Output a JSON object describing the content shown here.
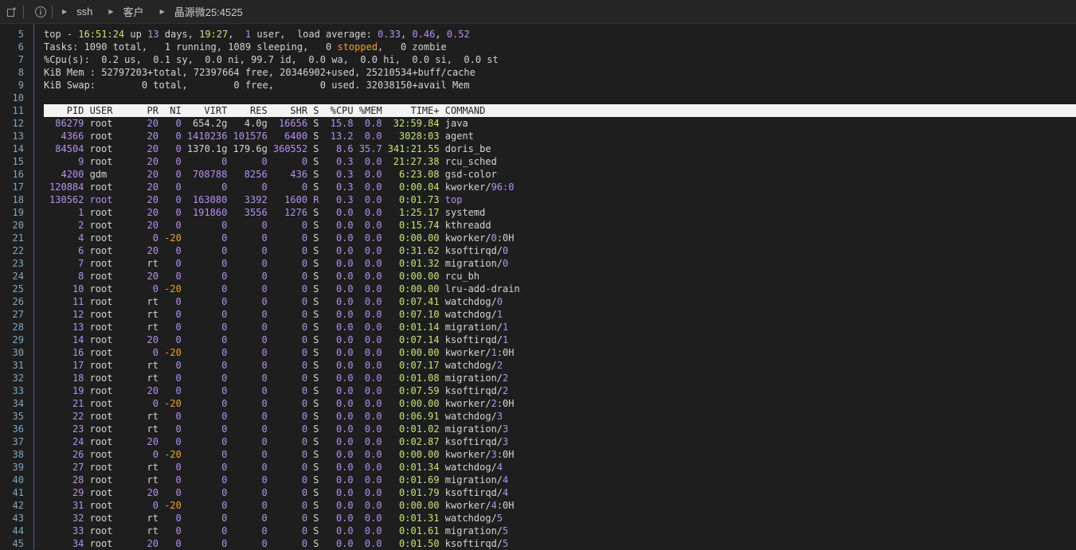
{
  "toolbar": {
    "breadcrumbs": [
      "ssh",
      "客户",
      "晶源微25:4525"
    ],
    "icons": {
      "new": "new-file-icon",
      "info": "info-icon",
      "triangle": "triangle-right-icon"
    }
  },
  "summary": {
    "line1": {
      "p1": "top - ",
      "time": "16:51:24",
      "p2": " up ",
      "days": "13",
      "p3": " days, ",
      "uptime": "19:27",
      "p4": ",  ",
      "users": "1",
      "p5": " user,  load average: ",
      "l1": "0.33",
      "p6": ", ",
      "l2": "0.46",
      "p7": ", ",
      "l3": "0.52"
    },
    "line2": {
      "p1": "Tasks: 1090 total,   1 running, 1089 sleeping,   0 ",
      "stopped": "stopped",
      "p2": ",   0 zombie"
    },
    "line3": "%Cpu(s):  0.2 us,  0.1 sy,  0.0 ni, 99.7 id,  0.0 wa,  0.0 hi,  0.0 si,  0.0 st",
    "line4": "KiB Mem : 52797203+total, 72397664 free, 20346902+used, 25210534+buff/cache",
    "line5": "KiB Swap:        0 total,        0 free,        0 used. 32038150+avail Mem"
  },
  "line_numbers": [
    "5",
    "6",
    "7",
    "8",
    "9",
    "10",
    "11",
    "12",
    "13",
    "14",
    "15",
    "16",
    "17",
    "18",
    "19",
    "20",
    "21",
    "22",
    "23",
    "24",
    "25",
    "26",
    "27",
    "28",
    "29",
    "30",
    "31",
    "32",
    "33",
    "34",
    "35",
    "36",
    "37",
    "38",
    "39",
    "40",
    "41",
    "42",
    "43",
    "44",
    "45"
  ],
  "header": [
    "PID",
    "USER",
    "PR",
    "NI",
    "VIRT",
    "RES",
    "SHR",
    "S",
    "%CPU",
    "%MEM",
    "TIME+",
    "COMMAND"
  ],
  "processes": [
    [
      "86279",
      "root",
      "20",
      "0",
      "654.2g",
      "4.0g",
      "16656",
      "S",
      "15.8",
      "0.8",
      "32:59.84",
      "java"
    ],
    [
      "4366",
      "root",
      "20",
      "0",
      "1410236",
      "101576",
      "6400",
      "S",
      "13.2",
      "0.0",
      "3028:03",
      "agent"
    ],
    [
      "84504",
      "root",
      "20",
      "0",
      "1370.1g",
      "179.6g",
      "360552",
      "S",
      "8.6",
      "35.7",
      "341:21.55",
      "doris_be"
    ],
    [
      "9",
      "root",
      "20",
      "0",
      "0",
      "0",
      "0",
      "S",
      "0.3",
      "0.0",
      "21:27.38",
      "rcu_sched"
    ],
    [
      "4200",
      "gdm",
      "20",
      "0",
      "708788",
      "8256",
      "436",
      "S",
      "0.3",
      "0.0",
      "6:23.08",
      "gsd-color"
    ],
    [
      "120884",
      "root",
      "20",
      "0",
      "0",
      "0",
      "0",
      "S",
      "0.3",
      "0.0",
      "0:00.04",
      "kworker/96:0"
    ],
    [
      "130562",
      "root",
      "20",
      "0",
      "163080",
      "3392",
      "1600",
      "R",
      "0.3",
      "0.0",
      "0:01.73",
      "top"
    ],
    [
      "1",
      "root",
      "20",
      "0",
      "191860",
      "3556",
      "1276",
      "S",
      "0.0",
      "0.0",
      "1:25.17",
      "systemd"
    ],
    [
      "2",
      "root",
      "20",
      "0",
      "0",
      "0",
      "0",
      "S",
      "0.0",
      "0.0",
      "0:15.74",
      "kthreadd"
    ],
    [
      "4",
      "root",
      "0",
      "-20",
      "0",
      "0",
      "0",
      "S",
      "0.0",
      "0.0",
      "0:00.00",
      "kworker/0:0H"
    ],
    [
      "6",
      "root",
      "20",
      "0",
      "0",
      "0",
      "0",
      "S",
      "0.0",
      "0.0",
      "0:31.62",
      "ksoftirqd/0"
    ],
    [
      "7",
      "root",
      "rt",
      "0",
      "0",
      "0",
      "0",
      "S",
      "0.0",
      "0.0",
      "0:01.32",
      "migration/0"
    ],
    [
      "8",
      "root",
      "20",
      "0",
      "0",
      "0",
      "0",
      "S",
      "0.0",
      "0.0",
      "0:00.00",
      "rcu_bh"
    ],
    [
      "10",
      "root",
      "0",
      "-20",
      "0",
      "0",
      "0",
      "S",
      "0.0",
      "0.0",
      "0:00.00",
      "lru-add-drain"
    ],
    [
      "11",
      "root",
      "rt",
      "0",
      "0",
      "0",
      "0",
      "S",
      "0.0",
      "0.0",
      "0:07.41",
      "watchdog/0"
    ],
    [
      "12",
      "root",
      "rt",
      "0",
      "0",
      "0",
      "0",
      "S",
      "0.0",
      "0.0",
      "0:07.10",
      "watchdog/1"
    ],
    [
      "13",
      "root",
      "rt",
      "0",
      "0",
      "0",
      "0",
      "S",
      "0.0",
      "0.0",
      "0:01.14",
      "migration/1"
    ],
    [
      "14",
      "root",
      "20",
      "0",
      "0",
      "0",
      "0",
      "S",
      "0.0",
      "0.0",
      "0:07.14",
      "ksoftirqd/1"
    ],
    [
      "16",
      "root",
      "0",
      "-20",
      "0",
      "0",
      "0",
      "S",
      "0.0",
      "0.0",
      "0:00.00",
      "kworker/1:0H"
    ],
    [
      "17",
      "root",
      "rt",
      "0",
      "0",
      "0",
      "0",
      "S",
      "0.0",
      "0.0",
      "0:07.17",
      "watchdog/2"
    ],
    [
      "18",
      "root",
      "rt",
      "0",
      "0",
      "0",
      "0",
      "S",
      "0.0",
      "0.0",
      "0:01.08",
      "migration/2"
    ],
    [
      "19",
      "root",
      "20",
      "0",
      "0",
      "0",
      "0",
      "S",
      "0.0",
      "0.0",
      "0:07.59",
      "ksoftirqd/2"
    ],
    [
      "21",
      "root",
      "0",
      "-20",
      "0",
      "0",
      "0",
      "S",
      "0.0",
      "0.0",
      "0:00.00",
      "kworker/2:0H"
    ],
    [
      "22",
      "root",
      "rt",
      "0",
      "0",
      "0",
      "0",
      "S",
      "0.0",
      "0.0",
      "0:06.91",
      "watchdog/3"
    ],
    [
      "23",
      "root",
      "rt",
      "0",
      "0",
      "0",
      "0",
      "S",
      "0.0",
      "0.0",
      "0:01.02",
      "migration/3"
    ],
    [
      "24",
      "root",
      "20",
      "0",
      "0",
      "0",
      "0",
      "S",
      "0.0",
      "0.0",
      "0:02.87",
      "ksoftirqd/3"
    ],
    [
      "26",
      "root",
      "0",
      "-20",
      "0",
      "0",
      "0",
      "S",
      "0.0",
      "0.0",
      "0:00.00",
      "kworker/3:0H"
    ],
    [
      "27",
      "root",
      "rt",
      "0",
      "0",
      "0",
      "0",
      "S",
      "0.0",
      "0.0",
      "0:01.34",
      "watchdog/4"
    ],
    [
      "28",
      "root",
      "rt",
      "0",
      "0",
      "0",
      "0",
      "S",
      "0.0",
      "0.0",
      "0:01.69",
      "migration/4"
    ],
    [
      "29",
      "root",
      "20",
      "0",
      "0",
      "0",
      "0",
      "S",
      "0.0",
      "0.0",
      "0:01.79",
      "ksoftirqd/4"
    ],
    [
      "31",
      "root",
      "0",
      "-20",
      "0",
      "0",
      "0",
      "S",
      "0.0",
      "0.0",
      "0:00.00",
      "kworker/4:0H"
    ],
    [
      "32",
      "root",
      "rt",
      "0",
      "0",
      "0",
      "0",
      "S",
      "0.0",
      "0.0",
      "0:01.31",
      "watchdog/5"
    ],
    [
      "33",
      "root",
      "rt",
      "0",
      "0",
      "0",
      "0",
      "S",
      "0.0",
      "0.0",
      "0:01.61",
      "migration/5"
    ],
    [
      "34",
      "root",
      "20",
      "0",
      "0",
      "0",
      "0",
      "S",
      "0.0",
      "0.0",
      "0:01.50",
      "ksoftirqd/5"
    ]
  ],
  "colors": {
    "number": "#b392f0",
    "time": "#c5e478",
    "warn": "#f0a030",
    "gutter": "#7fa7c4"
  }
}
